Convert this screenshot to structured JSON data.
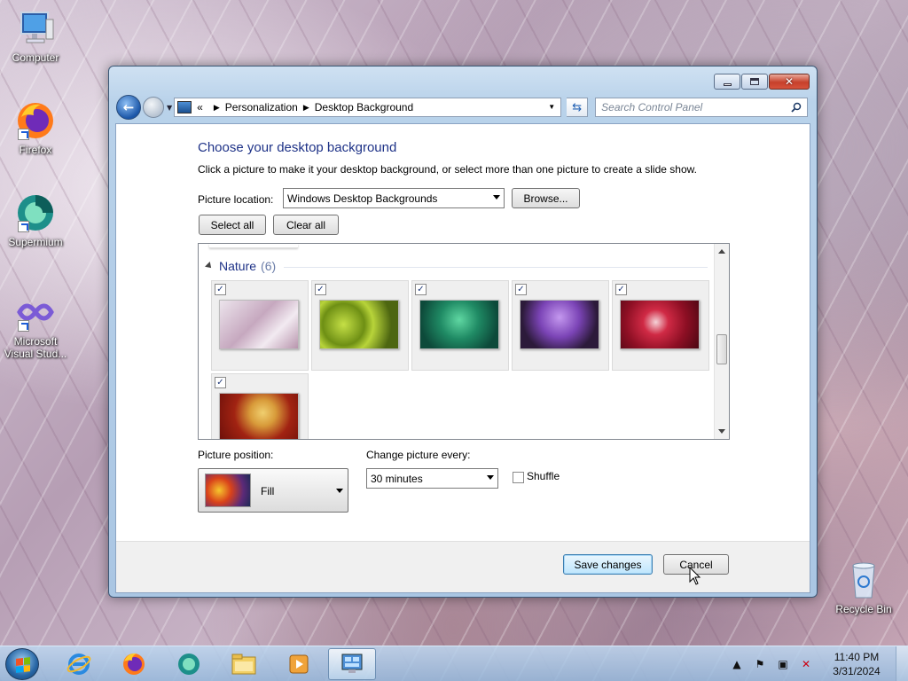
{
  "desktop": {
    "icons": [
      {
        "label": "Computer"
      },
      {
        "label": "Firefox"
      },
      {
        "label": "Supermium"
      },
      {
        "label": "Microsoft Visual Stud..."
      },
      {
        "label": "Recycle Bin"
      }
    ]
  },
  "window": {
    "breadcrumb": {
      "overflow": "«",
      "items": [
        "Personalization",
        "Desktop Background"
      ]
    },
    "search_placeholder": "Search Control Panel",
    "heading": "Choose your desktop background",
    "description": "Click a picture to make it your desktop background, or select more than one picture to create a slide show.",
    "picture_location_label": "Picture location:",
    "picture_location_value": "Windows Desktop Backgrounds",
    "browse_label": "Browse...",
    "select_all_label": "Select all",
    "clear_all_label": "Clear all",
    "group": {
      "name": "Nature",
      "count": "(6)"
    },
    "pictures": [
      {
        "name": "pink-flower",
        "checked": true,
        "colors": [
          "#d9ccd9",
          "#a5849b"
        ]
      },
      {
        "name": "green-succulent",
        "checked": true,
        "colors": [
          "#b4d13a",
          "#526b10"
        ]
      },
      {
        "name": "green-leaves",
        "checked": true,
        "colors": [
          "#2aa574",
          "#0c4536"
        ]
      },
      {
        "name": "purple-thistle",
        "checked": true,
        "colors": [
          "#8b57c2",
          "#2a1838"
        ]
      },
      {
        "name": "red-dahlia",
        "checked": true,
        "colors": [
          "#c9283e",
          "#5c0a17"
        ]
      },
      {
        "name": "autumn-leaves",
        "checked": true,
        "colors": [
          "#e0b24a",
          "#7a140c"
        ]
      }
    ],
    "picture_position_label": "Picture position:",
    "picture_position_value": "Fill",
    "change_every_label": "Change picture every:",
    "change_every_value": "30 minutes",
    "shuffle_label": "Shuffle",
    "shuffle_checked": false,
    "save_label": "Save changes",
    "cancel_label": "Cancel"
  },
  "taskbar": {
    "apps": [
      "Internet Explorer",
      "Firefox",
      "Supermium",
      "File Explorer",
      "Media Player",
      "Control Panel"
    ],
    "time": "11:40 PM",
    "date": "3/31/2024"
  }
}
